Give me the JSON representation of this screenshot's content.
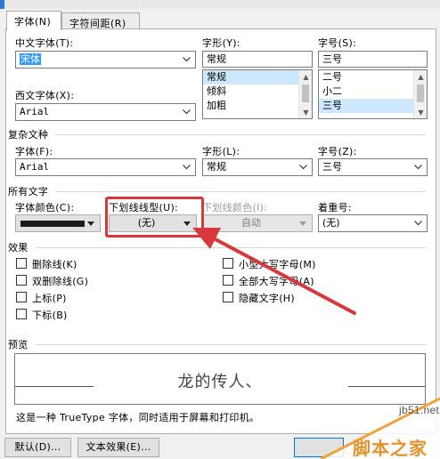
{
  "tabs": [
    {
      "label": "字体(N)",
      "active": true
    },
    {
      "label": "字符间距(R)",
      "active": false
    }
  ],
  "chinese_font": {
    "label": "中文字体(T):",
    "value": "宋体"
  },
  "style": {
    "label": "字形(Y):",
    "value": "常规",
    "options": [
      "常规",
      "倾斜",
      "加粗"
    ],
    "selected": "常规"
  },
  "size": {
    "label": "字号(S):",
    "value": "三号",
    "options": [
      "二号",
      "小二",
      "三号"
    ],
    "selected": "三号"
  },
  "western_font": {
    "label": "西文字体(X):",
    "value": "Arial"
  },
  "complex": {
    "section": "复杂文种",
    "font_label": "字体(F):",
    "font_value": "Arial",
    "style_label": "字形(L):",
    "style_value": "常规",
    "size_label": "字号(Z):",
    "size_value": "三号"
  },
  "all_text": {
    "section": "所有文字",
    "color_label": "字体颜色(C):",
    "underline_label": "下划线线型(U):",
    "underline_value": "(无)",
    "underline_color_label": "下划线颜色(I):",
    "underline_color_value": "自动",
    "emphasis_label": "着重号:",
    "emphasis_value": "(无)"
  },
  "effects": {
    "section": "效果",
    "left": [
      "删除线(K)",
      "双删除线(G)",
      "上标(P)",
      "下标(B)"
    ],
    "right": [
      "小型大写字母(M)",
      "全部大写字母(A)",
      "隐藏文字(H)"
    ]
  },
  "preview": {
    "section": "预览",
    "text": "龙的传人、"
  },
  "note": "这是一种 TrueType 字体，同时适用于屏幕和打印机。",
  "buttons": {
    "default": "默认(D)...",
    "text_effects": "文本效果(E)..."
  },
  "watermark": {
    "site": "jb51.net",
    "brand": "脚本之家"
  },
  "colors": {
    "accent": "#3399ff",
    "annotation_red": "#d9363e",
    "watermark_orange": "#f0a23a"
  }
}
